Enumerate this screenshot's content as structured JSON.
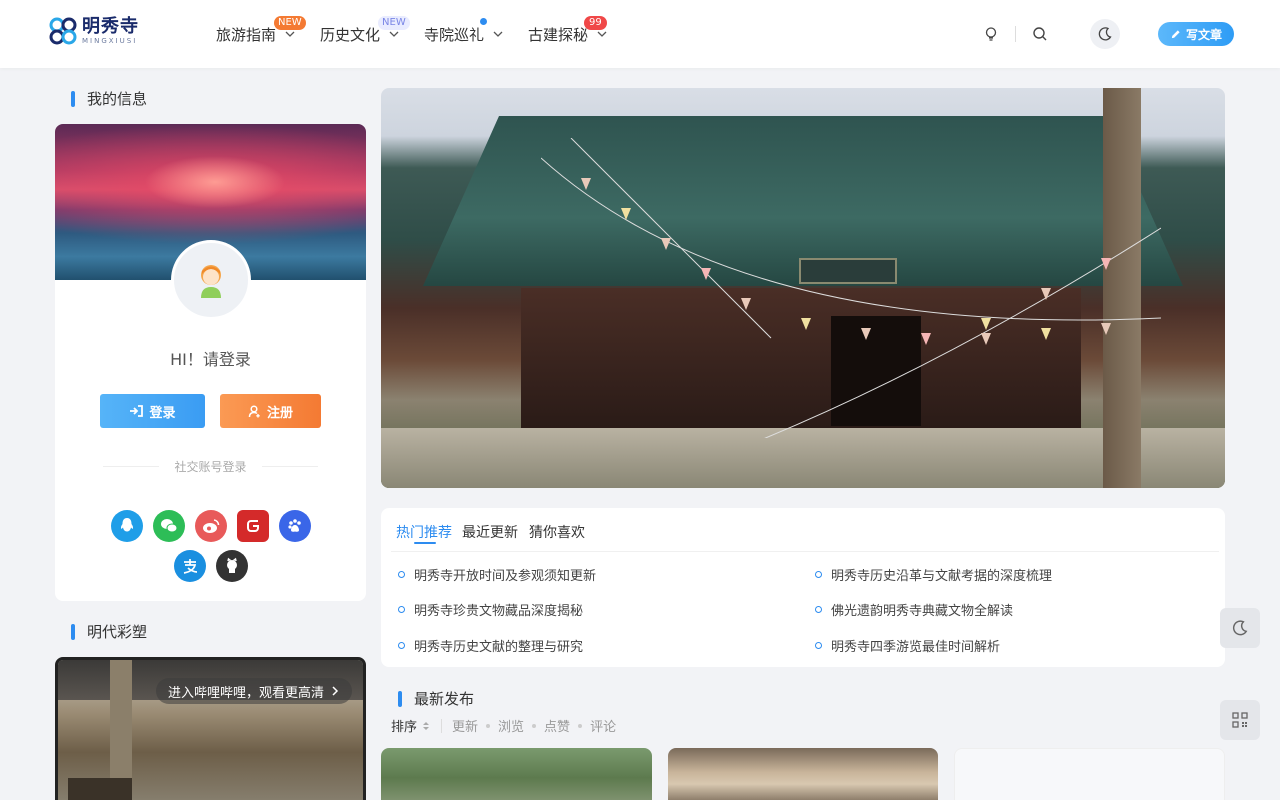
{
  "header": {
    "logo": {
      "name": "明秀寺",
      "subtitle": "MINGXIUSI"
    },
    "nav": [
      {
        "label": "旅游指南",
        "badge": "NEW",
        "badge_color": "#f47a33"
      },
      {
        "label": "历史文化",
        "badge": "NEW",
        "badge_color": "#aab4ff"
      },
      {
        "label": "寺院巡礼",
        "badge": "dot",
        "badge_color": "#2d8cf0"
      },
      {
        "label": "古建探秘",
        "badge": "99",
        "badge_color": "#f04848"
      }
    ],
    "write_label": "写文章"
  },
  "sidebar": {
    "my_info_title": "我的信息",
    "greeting": "HI！请登录",
    "login_label": "登录",
    "register_label": "注册",
    "social_label": "社交账号登录",
    "social_icons": [
      {
        "name": "qq-icon",
        "color": "#1f9ee8"
      },
      {
        "name": "wechat-icon",
        "color": "#2dbd57"
      },
      {
        "name": "weibo-icon",
        "color": "#e85a5a"
      },
      {
        "name": "gitee-icon",
        "color": "#d42a2a"
      },
      {
        "name": "baidu-icon",
        "color": "#3a66e8"
      },
      {
        "name": "alipay-icon",
        "color": "#1a8fe0"
      },
      {
        "name": "github-icon",
        "color": "#333333"
      }
    ],
    "video_title": "明代彩塑",
    "video_overlay": "进入哔哩哔哩，观看更高清"
  },
  "main": {
    "tabs": [
      "热门推荐",
      "最近更新",
      "猜你喜欢"
    ],
    "posts": [
      "明秀寺开放时间及参观须知更新",
      "明秀寺历史沿革与文献考据的深度梳理",
      "明秀寺珍贵文物藏品深度揭秘",
      "佛光遗韵明秀寺典藏文物全解读",
      "明秀寺历史文献的整理与研究",
      "明秀寺四季游览最佳时间解析"
    ],
    "latest_title": "最新发布",
    "sort": {
      "label": "排序",
      "options": [
        "更新",
        "浏览",
        "点赞",
        "评论"
      ]
    }
  },
  "colors": {
    "accent": "#2d8cf0",
    "register": "#f47a33"
  }
}
